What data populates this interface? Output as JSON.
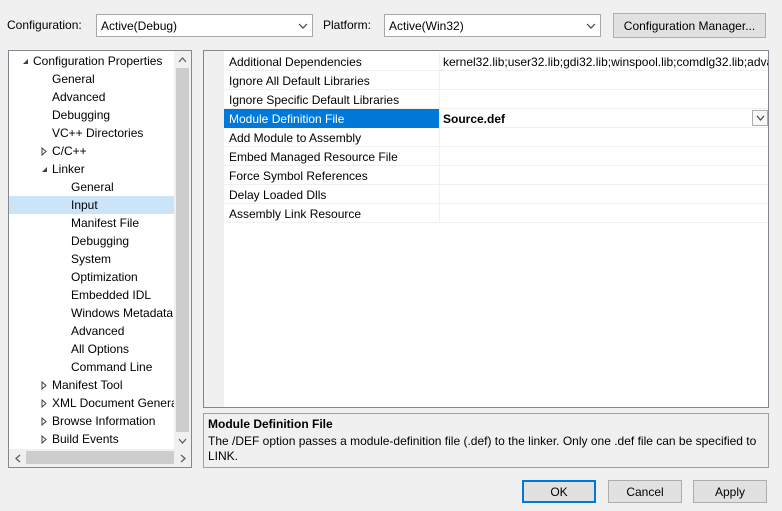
{
  "toolbar": {
    "configuration_label": "Configuration:",
    "configuration_value": "Active(Debug)",
    "platform_label": "Platform:",
    "platform_value": "Active(Win32)",
    "config_manager_label": "Configuration Manager..."
  },
  "tree": {
    "items": [
      {
        "label": "Configuration Properties",
        "level": 0,
        "expanded": true
      },
      {
        "label": "General",
        "level": 1
      },
      {
        "label": "Advanced",
        "level": 1
      },
      {
        "label": "Debugging",
        "level": 1
      },
      {
        "label": "VC++ Directories",
        "level": 1
      },
      {
        "label": "C/C++",
        "level": 1,
        "expandable": true
      },
      {
        "label": "Linker",
        "level": 1,
        "expanded": true
      },
      {
        "label": "General",
        "level": 2
      },
      {
        "label": "Input",
        "level": 2,
        "selected": true
      },
      {
        "label": "Manifest File",
        "level": 2
      },
      {
        "label": "Debugging",
        "level": 2
      },
      {
        "label": "System",
        "level": 2
      },
      {
        "label": "Optimization",
        "level": 2
      },
      {
        "label": "Embedded IDL",
        "level": 2
      },
      {
        "label": "Windows Metadata",
        "level": 2
      },
      {
        "label": "Advanced",
        "level": 2
      },
      {
        "label": "All Options",
        "level": 2
      },
      {
        "label": "Command Line",
        "level": 2
      },
      {
        "label": "Manifest Tool",
        "level": 1,
        "expandable": true
      },
      {
        "label": "XML Document Genera",
        "level": 1,
        "expandable": true
      },
      {
        "label": "Browse Information",
        "level": 1,
        "expandable": true
      },
      {
        "label": "Build Events",
        "level": 1,
        "expandable": true
      }
    ]
  },
  "properties": [
    {
      "name": "Additional Dependencies",
      "value": "kernel32.lib;user32.lib;gdi32.lib;winspool.lib;comdlg32.lib;adva"
    },
    {
      "name": "Ignore All Default Libraries",
      "value": ""
    },
    {
      "name": "Ignore Specific Default Libraries",
      "value": ""
    },
    {
      "name": "Module Definition File",
      "value": "Source.def",
      "selected": true
    },
    {
      "name": "Add Module to Assembly",
      "value": ""
    },
    {
      "name": "Embed Managed Resource File",
      "value": ""
    },
    {
      "name": "Force Symbol References",
      "value": ""
    },
    {
      "name": "Delay Loaded Dlls",
      "value": ""
    },
    {
      "name": "Assembly Link Resource",
      "value": ""
    }
  ],
  "description": {
    "title": "Module Definition File",
    "text": "The /DEF option passes a module-definition file (.def) to the linker. Only one .def file can be specified to LINK."
  },
  "buttons": {
    "ok": "OK",
    "cancel": "Cancel",
    "apply": "Apply"
  },
  "icons": {
    "combo_arrow": "chevron-down-icon",
    "tree_expanded": "triangle-expanded-icon",
    "tree_collapsed": "triangle-collapsed-icon"
  },
  "colors": {
    "selection": "#0078d7",
    "tree_selection": "#cce4f7"
  }
}
